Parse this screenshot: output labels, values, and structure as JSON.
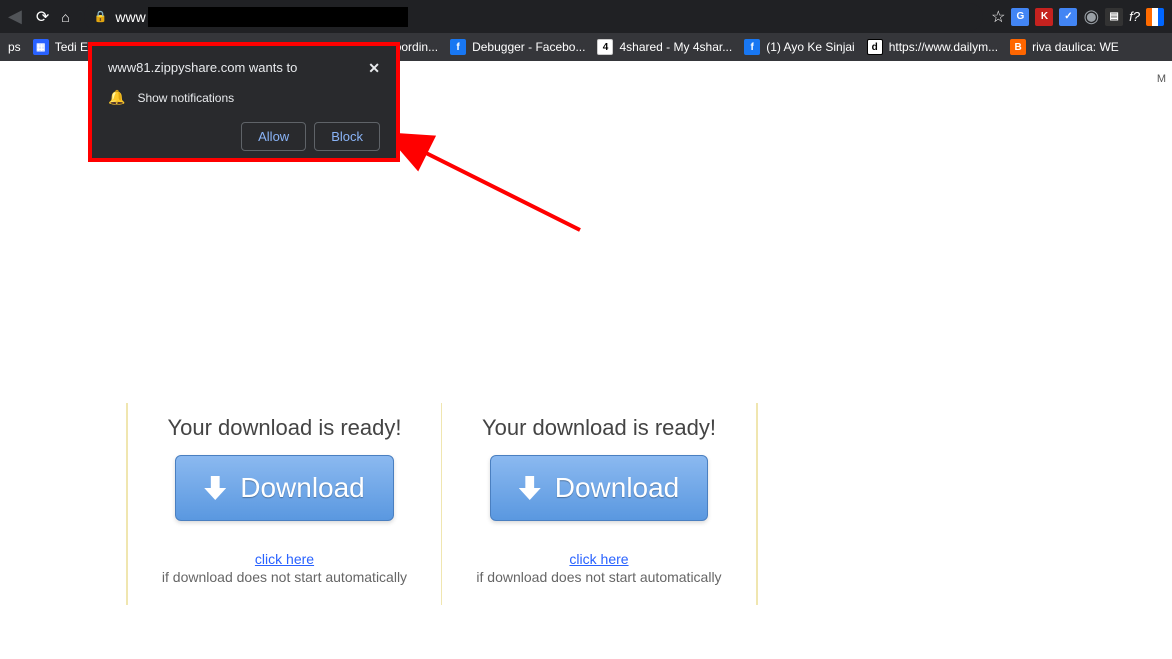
{
  "address_bar": {
    "url_prefix": "www"
  },
  "bookmarks": [
    {
      "label": "ps",
      "icon_class": ""
    },
    {
      "label": "Tedi Ek",
      "icon_class": "bm-blue"
    },
    {
      "label": "Coordin...",
      "icon_class": ""
    },
    {
      "label": "Debugger - Facebo...",
      "icon_class": "bm-fb",
      "icon_text": "f"
    },
    {
      "label": "4shared - My 4shar...",
      "icon_class": "bm-4s",
      "icon_text": "4"
    },
    {
      "label": "(1) Ayo Ke Sinjai",
      "icon_class": "bm-fb",
      "icon_text": "f"
    },
    {
      "label": "https://www.dailym...",
      "icon_class": "bm-d",
      "icon_text": "d"
    },
    {
      "label": "riva daulica: WE",
      "icon_class": "bm-b",
      "icon_text": "B"
    }
  ],
  "notification": {
    "title_text": "www81.zippyshare.com wants to",
    "body_text": "Show notifications",
    "allow_label": "Allow",
    "block_label": "Block"
  },
  "corner_label": "M",
  "download_cards": [
    {
      "title": "Your download is ready!",
      "button_label": "Download",
      "link_text": "click here",
      "auto_text": "if download does not start automatically"
    },
    {
      "title": "Your download is ready!",
      "button_label": "Download",
      "link_text": "click here",
      "auto_text": "if download does not start automatically"
    }
  ]
}
